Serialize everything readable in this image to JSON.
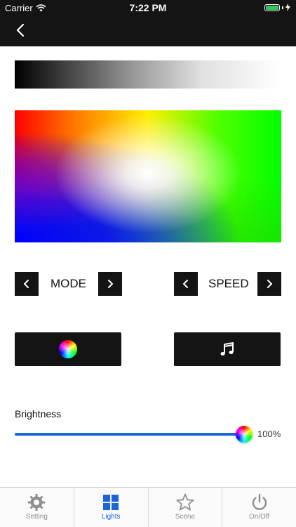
{
  "status": {
    "carrier": "Carrier",
    "time": "7:22 PM"
  },
  "controls": {
    "mode_label": "MODE",
    "speed_label": "SPEED"
  },
  "brightness": {
    "label": "Brightness",
    "value_text": "100%",
    "value": 1.0
  },
  "tabs": [
    {
      "label": "Setting",
      "icon": "gear-icon"
    },
    {
      "label": "Lights",
      "icon": "grid-icon",
      "active": true
    },
    {
      "label": "Scene",
      "icon": "star-icon"
    },
    {
      "label": "On/Off",
      "icon": "power-icon"
    }
  ],
  "colors": {
    "accent": "#1a66d6",
    "header": "#141414",
    "tab_inactive": "#8e8e93",
    "battery": "#34c759"
  }
}
